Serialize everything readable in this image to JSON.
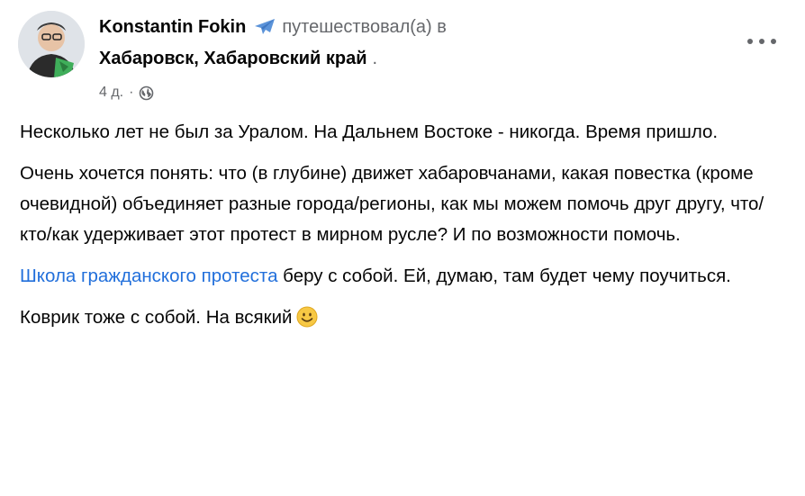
{
  "post": {
    "author": {
      "name": "Konstantin Fokin",
      "activity_icon": "airplane-icon",
      "activity_text": "путешествовал(а) в",
      "location": "Хабаровск, Хабаровский край",
      "location_suffix": "."
    },
    "meta": {
      "timestamp": "4 д.",
      "separator": "·",
      "privacy_icon": "globe-icon"
    },
    "more_icon": "more-options-icon",
    "body": {
      "p1": "Несколько лет не был за Уралом. На Дальнем Востоке - никогда. Время пришло.",
      "p2": "Очень хочется понять: что (в глубине) движет хабаровчанами, какая повестка (кроме очевидной) объединяет разные города/регионы, как мы можем помочь друг другу, что/кто/как удерживает этот протест в мирном русле? И по возможности помочь.",
      "p3_link": "Школа гражданского протеста",
      "p3_text": " беру с собой. Ей, думаю, там будет чему поучиться.",
      "p4": "Коврик тоже с собой. На всякий",
      "p4_emoji": "smile-emoji-icon"
    },
    "colors": {
      "link": "#216fdb",
      "secondary_text": "#65676b",
      "plane_icon": "#5b93d9"
    }
  }
}
